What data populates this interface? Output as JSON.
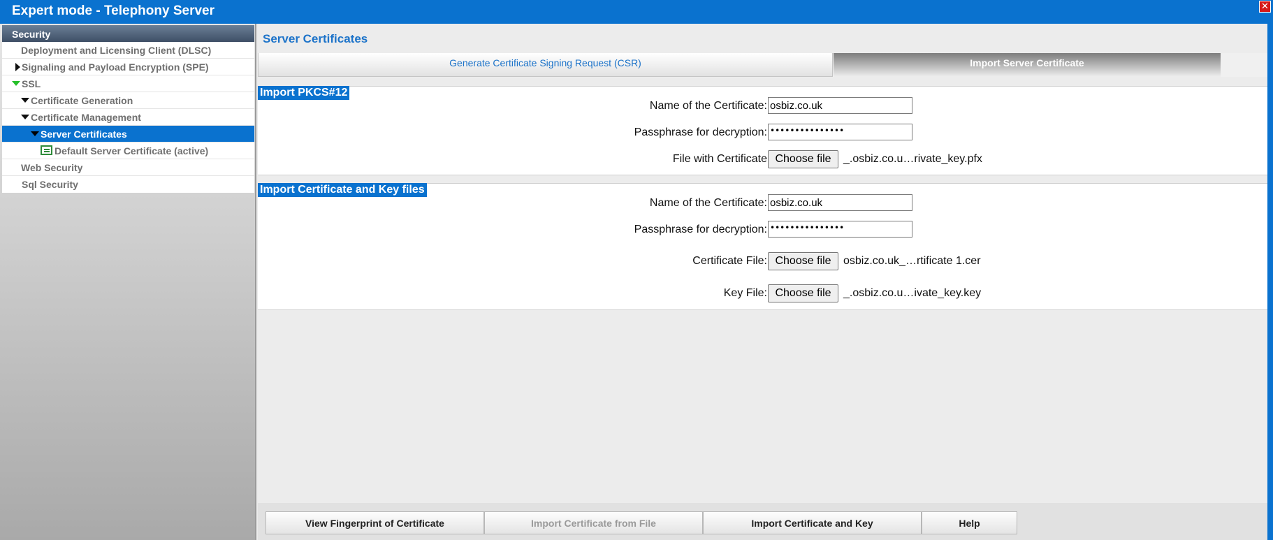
{
  "window": {
    "title": "Expert mode - Telephony Server",
    "close_glyph": "✕"
  },
  "sidebar": {
    "header": "Security",
    "items": [
      {
        "label": "Deployment and Licensing Client (DLSC)"
      },
      {
        "label": "Signaling and Payload Encryption (SPE)"
      },
      {
        "label": "SSL"
      },
      {
        "label": "Certificate Generation"
      },
      {
        "label": "Certificate Management"
      },
      {
        "label": "Server Certificates"
      },
      {
        "label": "Default Server Certificate (active)"
      },
      {
        "label": "Web Security"
      },
      {
        "label": "Sql Security"
      }
    ]
  },
  "main": {
    "title": "Server Certificates",
    "tabs": [
      {
        "label": "Generate Certificate Signing Request (CSR)"
      },
      {
        "label": "Import Server Certificate"
      }
    ],
    "pkcs": {
      "heading": "Import PKCS#12",
      "name_label": "Name of the Certificate:",
      "name_value": "osbiz.co.uk",
      "pass_label": "Passphrase for decryption:",
      "pass_value": "•••••••••••••••",
      "file_label": "File with Certificate",
      "choose_label": "Choose file",
      "file_name": "_.osbiz.co.u…rivate_key.pfx"
    },
    "keyfiles": {
      "heading": "Import Certificate and Key files",
      "name_label": "Name of the Certificate:",
      "name_value": "osbiz.co.uk",
      "pass_label": "Passphrase for decryption:",
      "pass_value": "•••••••••••••••",
      "cert_label": "Certificate File:",
      "cert_choose": "Choose file",
      "cert_file": "osbiz.co.uk_…rtificate 1.cer",
      "key_label": "Key File:",
      "key_choose": "Choose file",
      "key_file": "_.osbiz.co.u…ivate_key.key"
    },
    "buttons": {
      "fingerprint": "View Fingerprint of Certificate",
      "import_file": "Import Certificate from File",
      "import_key": "Import Certificate and Key",
      "help": "Help"
    }
  },
  "colors": {
    "accent": "#0a72cf",
    "tab_text": "#1c73c9",
    "ssl_triangle": "#27c02a"
  }
}
